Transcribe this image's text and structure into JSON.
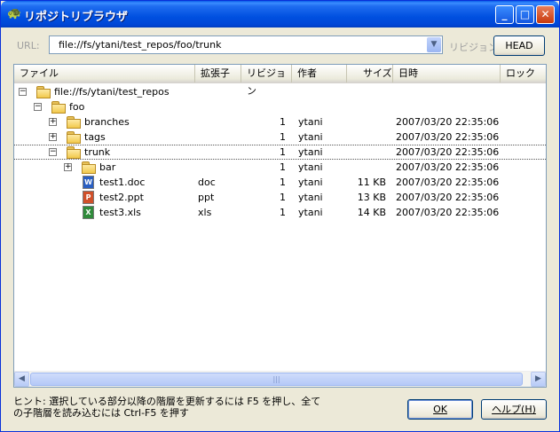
{
  "window": {
    "title": "リポジトリブラウザ"
  },
  "url_row": {
    "url_label": "URL:",
    "url_value": "file://fs/ytani/test_repos/foo/trunk",
    "revision_label": "リビジョン:",
    "head_button": "HEAD"
  },
  "columns": [
    "ファイル",
    "拡張子",
    "リビジョン",
    "作者",
    "サイズ",
    "日時",
    "ロック"
  ],
  "rows": [
    {
      "name": "file://fs/ytani/test_repos",
      "ext": "",
      "rev": "",
      "author": "",
      "size": "",
      "date": ""
    },
    {
      "name": "foo",
      "ext": "",
      "rev": "",
      "author": "",
      "size": "",
      "date": ""
    },
    {
      "name": "branches",
      "ext": "",
      "rev": "1",
      "author": "ytani",
      "size": "",
      "date": "2007/03/20 22:35:06"
    },
    {
      "name": "tags",
      "ext": "",
      "rev": "1",
      "author": "ytani",
      "size": "",
      "date": "2007/03/20 22:35:06"
    },
    {
      "name": "trunk",
      "ext": "",
      "rev": "1",
      "author": "ytani",
      "size": "",
      "date": "2007/03/20 22:35:06"
    },
    {
      "name": "bar",
      "ext": "",
      "rev": "1",
      "author": "ytani",
      "size": "",
      "date": "2007/03/20 22:35:06"
    },
    {
      "name": "test1.doc",
      "ext": "doc",
      "rev": "1",
      "author": "ytani",
      "size": "11 KB",
      "date": "2007/03/20 22:35:06"
    },
    {
      "name": "test2.ppt",
      "ext": "ppt",
      "rev": "1",
      "author": "ytani",
      "size": "13 KB",
      "date": "2007/03/20 22:35:06"
    },
    {
      "name": "test3.xls",
      "ext": "xls",
      "rev": "1",
      "author": "ytani",
      "size": "14 KB",
      "date": "2007/03/20 22:35:06"
    }
  ],
  "hint": {
    "line1": "ヒント: 選択している部分以降の階層を更新するには F5 を押し、全て",
    "line2": "の子階層を読み込むには Ctrl-F5 を押す"
  },
  "buttons": {
    "ok": "OK",
    "help": "ヘルプ(H)"
  },
  "colors": {
    "title_bar": "#0050e0",
    "window_bg": "#ece9d8",
    "border": "#7f9db9"
  }
}
